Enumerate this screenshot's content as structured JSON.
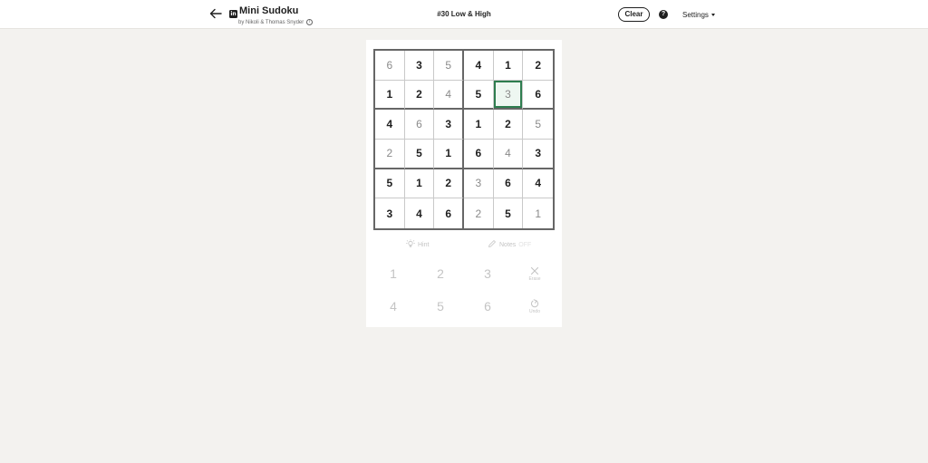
{
  "header": {
    "app_title": "Mini Sudoku",
    "byline": "by Nikoli & Thomas Snyder",
    "puzzle_title": "#30 Low & High",
    "clear_label": "Clear",
    "help_label": "?",
    "settings_label": "Settings",
    "brand_icon": "in",
    "info_icon": "i"
  },
  "board": {
    "size": 6,
    "selected": [
      1,
      4
    ],
    "accent_color": "#2e7d4f",
    "rows": [
      [
        {
          "v": "6",
          "given": false
        },
        {
          "v": "3",
          "given": true
        },
        {
          "v": "5",
          "given": false
        },
        {
          "v": "4",
          "given": true
        },
        {
          "v": "1",
          "given": true
        },
        {
          "v": "2",
          "given": true
        }
      ],
      [
        {
          "v": "1",
          "given": true
        },
        {
          "v": "2",
          "given": true
        },
        {
          "v": "4",
          "given": false
        },
        {
          "v": "5",
          "given": true
        },
        {
          "v": "3",
          "given": false
        },
        {
          "v": "6",
          "given": true
        }
      ],
      [
        {
          "v": "4",
          "given": true
        },
        {
          "v": "6",
          "given": false
        },
        {
          "v": "3",
          "given": true
        },
        {
          "v": "1",
          "given": true
        },
        {
          "v": "2",
          "given": true
        },
        {
          "v": "5",
          "given": false
        }
      ],
      [
        {
          "v": "2",
          "given": false
        },
        {
          "v": "5",
          "given": true
        },
        {
          "v": "1",
          "given": true
        },
        {
          "v": "6",
          "given": true
        },
        {
          "v": "4",
          "given": false
        },
        {
          "v": "3",
          "given": true
        }
      ],
      [
        {
          "v": "5",
          "given": true
        },
        {
          "v": "1",
          "given": true
        },
        {
          "v": "2",
          "given": true
        },
        {
          "v": "3",
          "given": false
        },
        {
          "v": "6",
          "given": true
        },
        {
          "v": "4",
          "given": true
        }
      ],
      [
        {
          "v": "3",
          "given": true
        },
        {
          "v": "4",
          "given": true
        },
        {
          "v": "6",
          "given": true
        },
        {
          "v": "2",
          "given": false
        },
        {
          "v": "5",
          "given": true
        },
        {
          "v": "1",
          "given": false
        }
      ]
    ]
  },
  "tools": {
    "hint_label": "Hint",
    "notes_label": "Notes",
    "notes_state": "OFF"
  },
  "keypad": {
    "digits": [
      "1",
      "2",
      "3",
      "4",
      "5",
      "6"
    ],
    "erase_label": "Erase",
    "undo_label": "Undo"
  }
}
